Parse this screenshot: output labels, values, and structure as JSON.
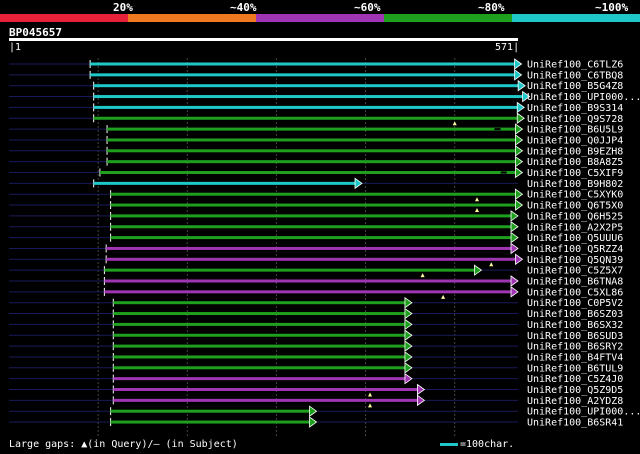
{
  "legend": {
    "labels": [
      "20%",
      "~40%",
      "~60%",
      "~80%",
      "~100%"
    ],
    "colors": [
      "#e8213a",
      "#f07820",
      "#a035b4",
      "#1ea01e",
      "#1ec8c8"
    ]
  },
  "query": {
    "id": "BP045657",
    "start": "1",
    "end": "571",
    "length": 571
  },
  "footer": {
    "gaps_text": "Large gaps: ▲(in Query)/– (in Subject)",
    "scale_text": "=100char.",
    "scale_color": "#1ec8c8"
  },
  "hits": [
    {
      "label": "UniRef100_C6TLZ6",
      "start": 91,
      "end": 575,
      "color": "#1ec8c8",
      "qgaps": [],
      "sgaps": []
    },
    {
      "label": "UniRef100_C6TBQ8",
      "start": 91,
      "end": 575,
      "color": "#1ec8c8",
      "qgaps": [],
      "sgaps": []
    },
    {
      "label": "UniRef100_B5G4Z8",
      "start": 95,
      "end": 579,
      "color": "#1ec8c8",
      "qgaps": [],
      "sgaps": []
    },
    {
      "label": "UniRef100_UPI000...",
      "start": 95,
      "end": 584,
      "color": "#1ec8c8",
      "qgaps": [],
      "sgaps": []
    },
    {
      "label": "UniRef100_B9S314",
      "start": 95,
      "end": 578,
      "color": "#1ec8c8",
      "qgaps": [],
      "sgaps": []
    },
    {
      "label": "UniRef100_Q9S728",
      "start": 95,
      "end": 578,
      "color": "#1ea01e",
      "qgaps": [
        500
      ],
      "sgaps": []
    },
    {
      "label": "UniRef100_B6U5L9",
      "start": 110,
      "end": 576,
      "color": "#1ea01e",
      "qgaps": [],
      "sgaps": [
        548
      ]
    },
    {
      "label": "UniRef100_Q0JJP4",
      "start": 110,
      "end": 576,
      "color": "#1ea01e",
      "qgaps": [],
      "sgaps": []
    },
    {
      "label": "UniRef100_B9EZH8",
      "start": 110,
      "end": 576,
      "color": "#1ea01e",
      "qgaps": [],
      "sgaps": []
    },
    {
      "label": "UniRef100_B8A8Z5",
      "start": 110,
      "end": 576,
      "color": "#1ea01e",
      "qgaps": [],
      "sgaps": []
    },
    {
      "label": "UniRef100_C5XIF9",
      "start": 102,
      "end": 576,
      "color": "#1ea01e",
      "qgaps": [],
      "sgaps": [
        555
      ]
    },
    {
      "label": "UniRef100_B9H802",
      "start": 95,
      "end": 396,
      "color": "#1ec8c8",
      "qgaps": [],
      "sgaps": []
    },
    {
      "label": "UniRef100_C5XYK0",
      "start": 114,
      "end": 576,
      "color": "#1ea01e",
      "qgaps": [
        525
      ],
      "sgaps": []
    },
    {
      "label": "UniRef100_Q6T5X0",
      "start": 114,
      "end": 576,
      "color": "#1ea01e",
      "qgaps": [
        525
      ],
      "sgaps": []
    },
    {
      "label": "UniRef100_Q6H525",
      "start": 114,
      "end": 571,
      "color": "#1ea01e",
      "qgaps": [],
      "sgaps": []
    },
    {
      "label": "UniRef100_A2X2P5",
      "start": 114,
      "end": 571,
      "color": "#1ea01e",
      "qgaps": [],
      "sgaps": []
    },
    {
      "label": "UniRef100_Q5UUU6",
      "start": 114,
      "end": 571,
      "color": "#1ea01e",
      "qgaps": [],
      "sgaps": []
    },
    {
      "label": "UniRef100_Q5RZZ4",
      "start": 109,
      "end": 571,
      "color": "#a035b4",
      "qgaps": [],
      "sgaps": []
    },
    {
      "label": "UniRef100_Q5QN39",
      "start": 109,
      "end": 576,
      "color": "#a035b4",
      "qgaps": [
        541
      ],
      "sgaps": []
    },
    {
      "label": "UniRef100_C5Z5X7",
      "start": 107,
      "end": 530,
      "color": "#1ea01e",
      "qgaps": [
        464
      ],
      "sgaps": []
    },
    {
      "label": "UniRef100_B6TNA8",
      "start": 107,
      "end": 571,
      "color": "#a035b4",
      "qgaps": [],
      "sgaps": []
    },
    {
      "label": "UniRef100_C5XL86",
      "start": 107,
      "end": 571,
      "color": "#a035b4",
      "qgaps": [
        487
      ],
      "sgaps": []
    },
    {
      "label": "UniRef100_C0P5V2",
      "start": 117,
      "end": 452,
      "color": "#1ea01e",
      "qgaps": [],
      "sgaps": []
    },
    {
      "label": "UniRef100_B6SZ03",
      "start": 117,
      "end": 452,
      "color": "#1ea01e",
      "qgaps": [],
      "sgaps": []
    },
    {
      "label": "UniRef100_B6SX32",
      "start": 117,
      "end": 452,
      "color": "#1ea01e",
      "qgaps": [],
      "sgaps": []
    },
    {
      "label": "UniRef100_B6SUD3",
      "start": 117,
      "end": 452,
      "color": "#1ea01e",
      "qgaps": [],
      "sgaps": []
    },
    {
      "label": "UniRef100_B6SRY2",
      "start": 117,
      "end": 452,
      "color": "#1ea01e",
      "qgaps": [],
      "sgaps": []
    },
    {
      "label": "UniRef100_B4FTV4",
      "start": 117,
      "end": 452,
      "color": "#1ea01e",
      "qgaps": [],
      "sgaps": []
    },
    {
      "label": "UniRef100_B6TUL9",
      "start": 117,
      "end": 452,
      "color": "#1ea01e",
      "qgaps": [],
      "sgaps": []
    },
    {
      "label": "UniRef100_C5Z4J0",
      "start": 117,
      "end": 452,
      "color": "#a035b4",
      "qgaps": [],
      "sgaps": []
    },
    {
      "label": "UniRef100_Q5Z9D5",
      "start": 117,
      "end": 466,
      "color": "#a035b4",
      "qgaps": [
        405
      ],
      "sgaps": []
    },
    {
      "label": "UniRef100_A2YDZ8",
      "start": 117,
      "end": 466,
      "color": "#a035b4",
      "qgaps": [
        405
      ],
      "sgaps": []
    },
    {
      "label": "UniRef100_UPI000...",
      "start": 114,
      "end": 345,
      "color": "#1ea01e",
      "qgaps": [],
      "sgaps": []
    },
    {
      "label": "UniRef100_B6SR41",
      "start": 114,
      "end": 345,
      "color": "#1ea01e",
      "qgaps": [],
      "sgaps": []
    }
  ]
}
